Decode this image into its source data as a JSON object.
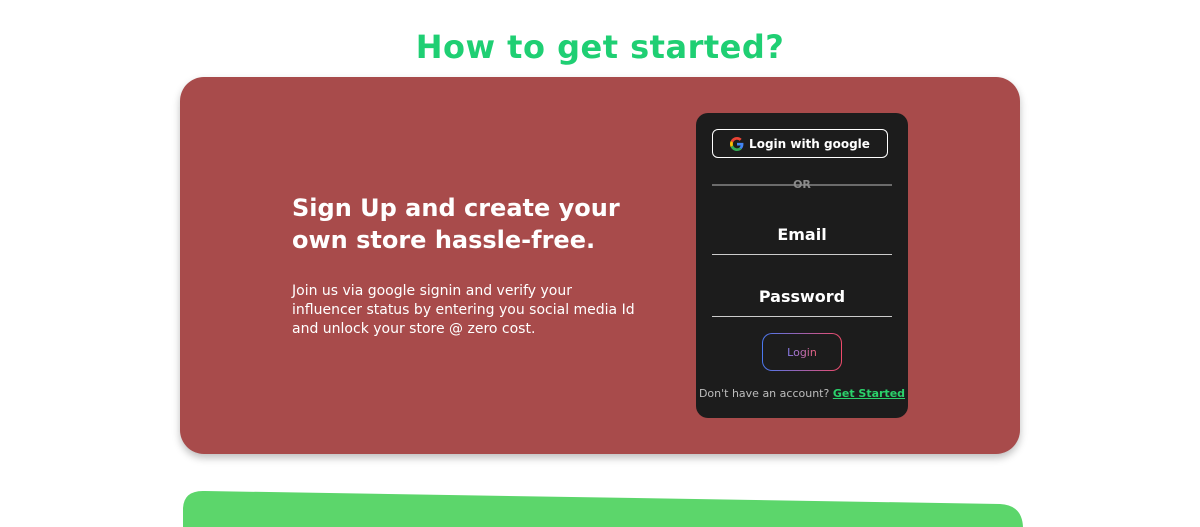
{
  "section": {
    "title": "How to get started?",
    "title_color": "#1fcf73"
  },
  "card": {
    "background": "#a84b4b",
    "title": "Sign Up and create your own store hassle-free.",
    "description": "Join us via google signin and verify your influencer status by entering you social media Id and unlock your store @ zero cost."
  },
  "login": {
    "background": "#1c1c1c",
    "google_label": "Login with google",
    "or_label": "OR",
    "email_placeholder": "Email",
    "password_placeholder": "Password",
    "login_label": "Login",
    "no_account_text": "Don't have an account?",
    "get_started_label": "Get Started"
  },
  "next_section": {
    "background": "#5cd66b"
  },
  "icons": {
    "google": "google-icon"
  }
}
